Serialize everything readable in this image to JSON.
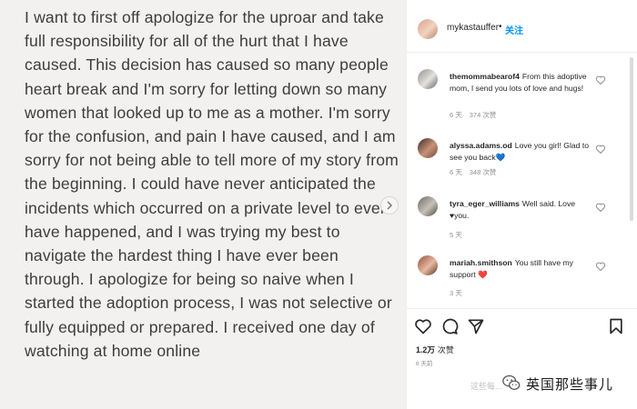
{
  "post": {
    "text": "I want to first off apologize for the uproar and take full responsibility for all of the hurt that I have caused. This decision has caused so many people heart break and I'm sorry for letting down so many women that looked up to me as a mother. I'm sorry for the confusion, and pain I have caused, and I am sorry for not being able to tell more of my story from the beginning. I could have never anticipated the incidents which occurred on a private level to ever have happened, and I was trying my best to navigate the hardest thing I have ever been through. I apologize for being so naive when I started the adoption process, I was not selective or fully equipped or prepared. I received one day of watching at home online"
  },
  "header": {
    "username": "mykastauffer",
    "separator": "•",
    "follow_label": "关注"
  },
  "comments": [
    {
      "username": "themommabearof4",
      "text": "From this adoptive mom, I send you lots of love and hugs!",
      "age": "6 天",
      "likes": "374 次赞"
    },
    {
      "username": "alyssa.adams.od",
      "text": "Love you girl! Glad to see you back",
      "emoji": "💙",
      "age": "6 天",
      "likes": "348 次赞"
    },
    {
      "username": "tyra_eger_williams",
      "text": "Well said. Love",
      "emoji": "♥",
      "text_after": "you.",
      "age": "5 天",
      "likes": ""
    },
    {
      "username": "mariah.smithson",
      "text": "You still have my support",
      "emoji": "❤️",
      "age": "3 天",
      "likes": ""
    }
  ],
  "footer": {
    "likes_count": "1.2万",
    "likes_label": "次赞",
    "time": "6 天前"
  },
  "watermark": {
    "faint": "这些每...",
    "text": "英国那些事儿"
  },
  "colors": {
    "link": "#0095f6",
    "media_bg": "#f2f1f0",
    "text": "#3d3d3d",
    "heart": "#e0245e"
  },
  "icons": [
    "chevron-right-icon",
    "heart-icon",
    "comment-icon",
    "share-icon",
    "bookmark-icon",
    "wechat-icon"
  ]
}
